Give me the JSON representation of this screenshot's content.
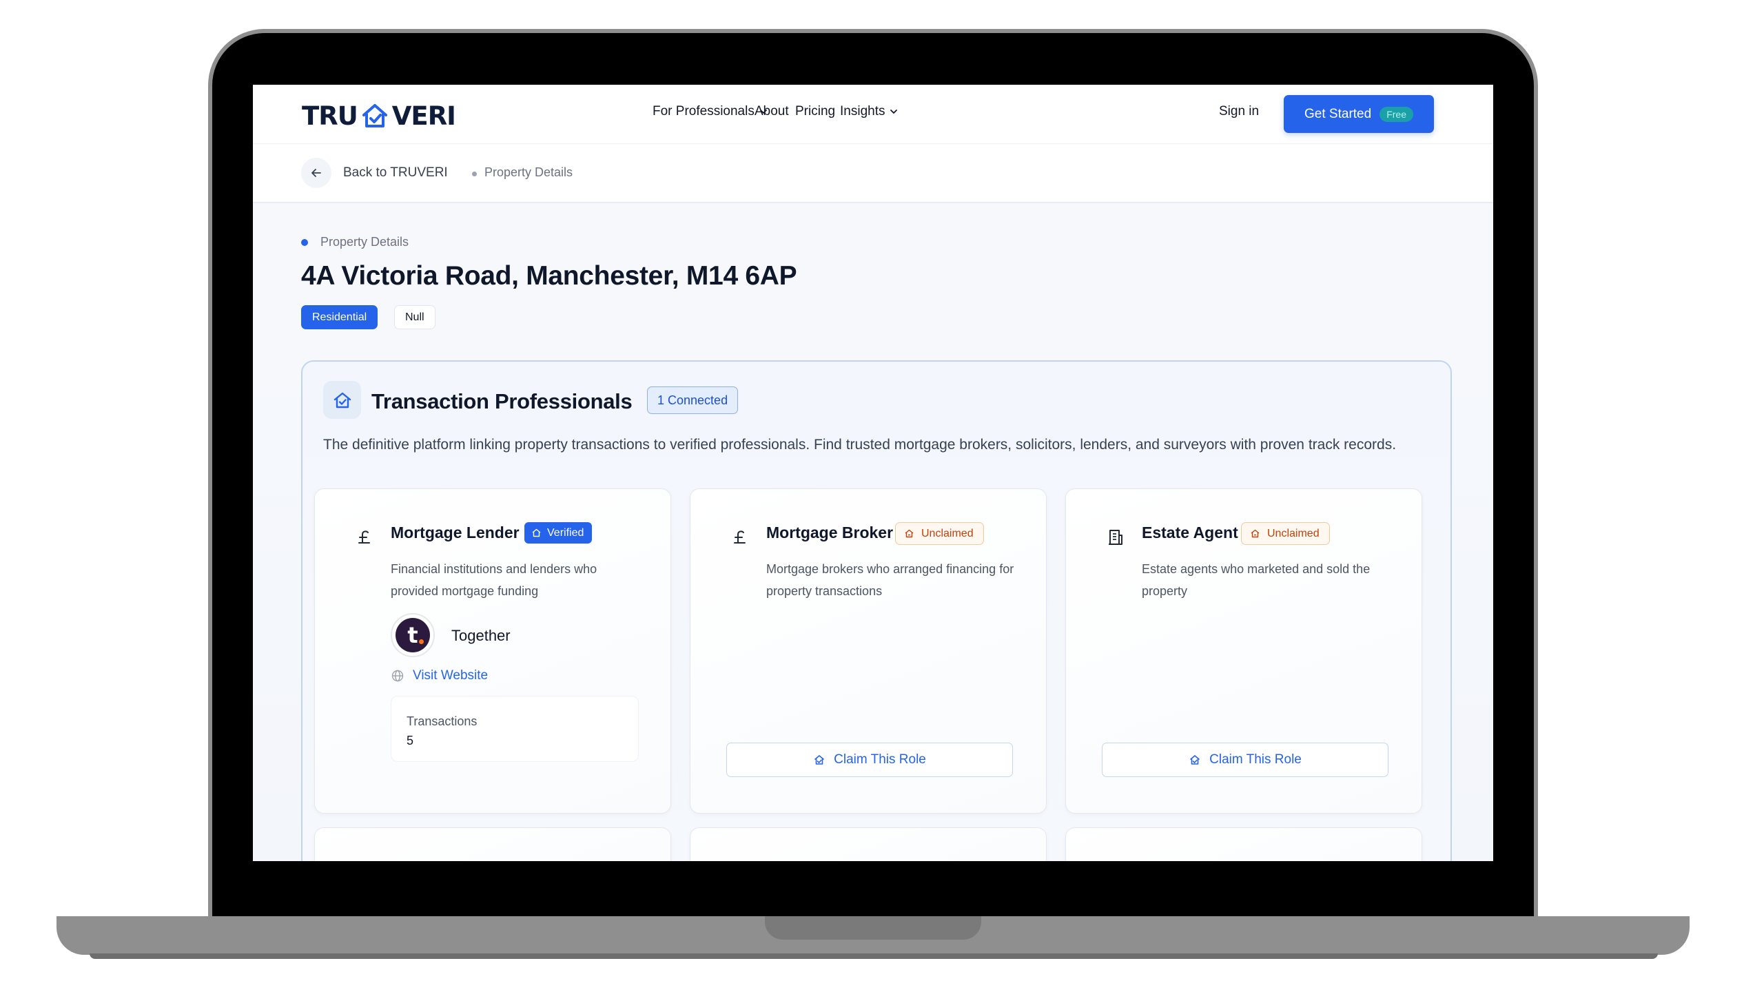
{
  "brand": {
    "logo_left": "TRU",
    "logo_right": "VERI",
    "accent": "#2563eb"
  },
  "nav": {
    "items": [
      {
        "label": "For Professionals",
        "has_dropdown": true
      },
      {
        "label": "About",
        "has_dropdown": false
      },
      {
        "label": "Pricing",
        "has_dropdown": false
      },
      {
        "label": "Insights",
        "has_dropdown": true
      }
    ],
    "sign_in": "Sign in",
    "get_started": "Get Started",
    "free_badge": "Free"
  },
  "breadcrumb": {
    "back_label": "Back to TRUVERI",
    "current": "Property Details"
  },
  "property": {
    "kicker": "Property Details",
    "title": "4A Victoria Road, Manchester, M14 6AP",
    "tags": [
      "Residential",
      "Null"
    ]
  },
  "professionals": {
    "title": "Transaction Professionals",
    "connected_badge": "1 Connected",
    "description": "The definitive platform linking property transactions to verified professionals. Find trusted mortgage brokers, solicitors, lenders, and surveyors with proven track records.",
    "cards": [
      {
        "icon": "pound-icon",
        "title": "Mortgage Lender",
        "status": "Verified",
        "description": "Financial institutions and lenders who provided mortgage funding",
        "org_logo_letter": "t",
        "org_name": "Together",
        "visit_label": "Visit Website",
        "stats_label": "Transactions",
        "stats_value": "5"
      },
      {
        "icon": "pound-icon",
        "title": "Mortgage Broker",
        "status": "Unclaimed",
        "description": "Mortgage brokers who arranged financing for property transactions",
        "claim_label": "Claim This Role"
      },
      {
        "icon": "building-icon",
        "title": "Estate Agent",
        "status": "Unclaimed",
        "description": "Estate agents who marketed and sold the property",
        "claim_label": "Claim This Role"
      }
    ]
  },
  "colors": {
    "verified": "#2563eb",
    "unclaimed_text": "#c2410c",
    "unclaimed_border": "#f7c99a",
    "free_badge_bg": "#1aa1a8"
  }
}
